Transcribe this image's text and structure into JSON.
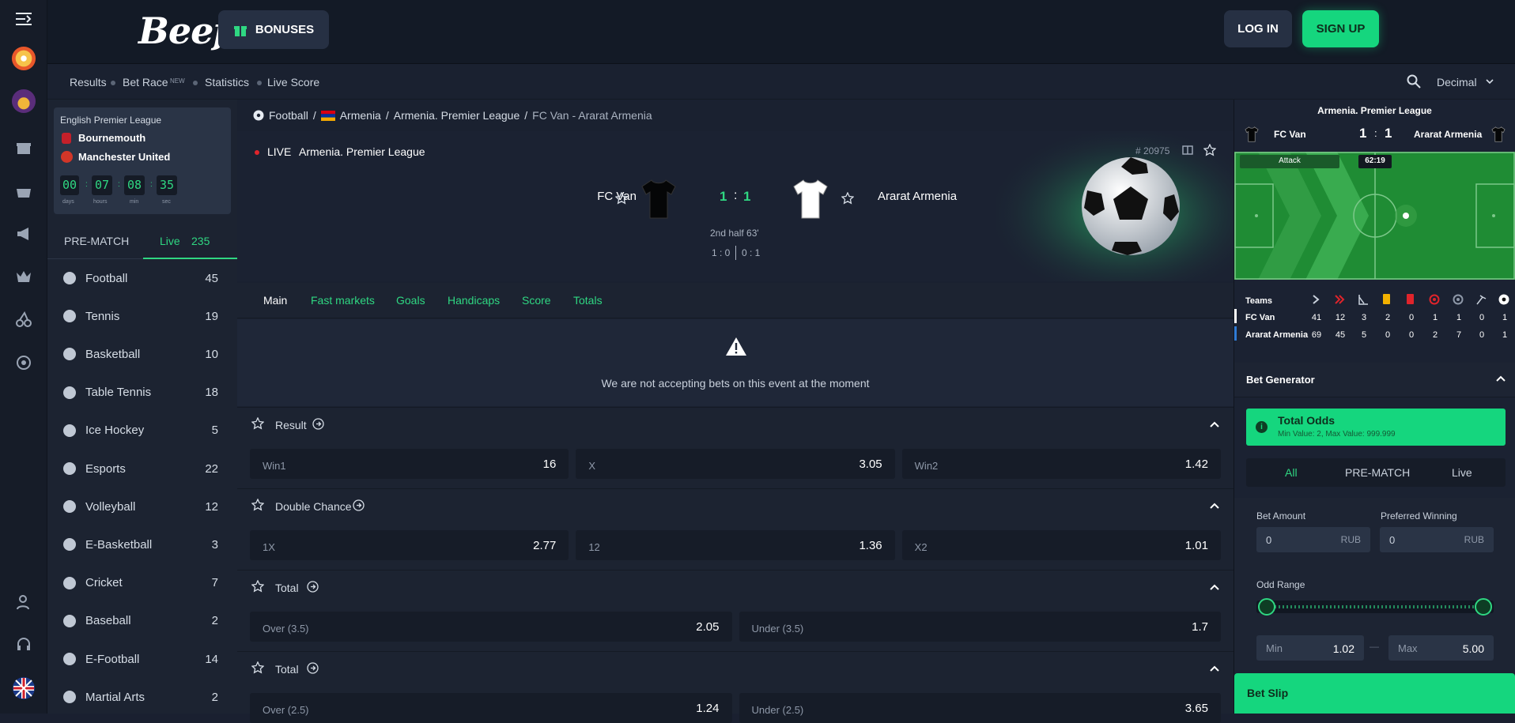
{
  "header": {
    "logo": "Beef",
    "bonuses_label": "BONUSES",
    "login_label": "LOG IN",
    "signup_label": "SIGN UP"
  },
  "subnav": {
    "items": [
      "Results",
      "Bet Race",
      "Statistics",
      "Live Score"
    ],
    "new_badge": "NEW",
    "odds_format": "Decimal"
  },
  "promo": {
    "league": "English Premier League",
    "team1": "Bournemouth",
    "team2": "Manchester United",
    "countdown": [
      {
        "value": "00",
        "unit": "days"
      },
      {
        "value": "07",
        "unit": "hours"
      },
      {
        "value": "08",
        "unit": "min"
      },
      {
        "value": "35",
        "unit": "sec"
      }
    ]
  },
  "sidebar": {
    "tab_prematch": "PRE-MATCH",
    "tab_live": "Live",
    "live_count": "235",
    "sports": [
      {
        "name": "Football",
        "count": "45"
      },
      {
        "name": "Tennis",
        "count": "19"
      },
      {
        "name": "Basketball",
        "count": "10"
      },
      {
        "name": "Table Tennis",
        "count": "18"
      },
      {
        "name": "Ice Hockey",
        "count": "5"
      },
      {
        "name": "Esports",
        "count": "22"
      },
      {
        "name": "Volleyball",
        "count": "12"
      },
      {
        "name": "E-Basketball",
        "count": "3"
      },
      {
        "name": "Cricket",
        "count": "7"
      },
      {
        "name": "Baseball",
        "count": "2"
      },
      {
        "name": "E-Football",
        "count": "14"
      },
      {
        "name": "Martial Arts",
        "count": "2"
      }
    ]
  },
  "breadcrumb": {
    "sport": "Football",
    "country": "Armenia",
    "league": "Armenia. Premier League",
    "event": "FC Van - Ararat Armenia"
  },
  "event": {
    "live_label": "LIVE",
    "league": "Armenia. Premier League",
    "event_id": "# 20975",
    "home": "FC Van",
    "away": "Ararat Armenia",
    "score_home": "1",
    "score_away": "1",
    "period": "2nd half 63'",
    "half1": "1 : 0",
    "half2": "0 : 1"
  },
  "market_tabs": [
    "Main",
    "Fast markets",
    "Goals",
    "Handicaps",
    "Score",
    "Totals"
  ],
  "notice": "We are not accepting bets on this event at the moment",
  "markets": [
    {
      "title": "Result",
      "odds": [
        {
          "label": "Win1",
          "value": "16"
        },
        {
          "label": "X",
          "value": "3.05"
        },
        {
          "label": "Win2",
          "value": "1.42"
        }
      ]
    },
    {
      "title": "Double Chance",
      "odds": [
        {
          "label": "1X",
          "value": "2.77"
        },
        {
          "label": "12",
          "value": "1.36"
        },
        {
          "label": "X2",
          "value": "1.01"
        }
      ]
    },
    {
      "title": "Total",
      "odds": [
        {
          "label": "Over (3.5)",
          "value": "2.05"
        },
        {
          "label": "Under (3.5)",
          "value": "1.7"
        }
      ]
    },
    {
      "title": "Total",
      "odds": [
        {
          "label": "Over (2.5)",
          "value": "1.24"
        },
        {
          "label": "Under (2.5)",
          "value": "3.65"
        }
      ]
    }
  ],
  "tracker": {
    "league": "Armenia. Premier League",
    "home": "FC Van",
    "away": "Ararat Armenia",
    "score_home": "1",
    "score_away": "1",
    "attack_label": "Attack",
    "clock": "62:19"
  },
  "stats": {
    "teams_label": "Teams",
    "rows": [
      {
        "team": "FC Van",
        "values": [
          "41",
          "12",
          "3",
          "2",
          "0",
          "1",
          "1",
          "0",
          "1"
        ]
      },
      {
        "team": "Ararat Armenia",
        "values": [
          "69",
          "45",
          "5",
          "0",
          "0",
          "2",
          "7",
          "0",
          "1"
        ]
      }
    ]
  },
  "bet_generator": {
    "title": "Bet Generator",
    "total_odds_title": "Total Odds",
    "total_odds_hint": "Min Value: 2, Max Value: 999.999",
    "tabs": [
      "All",
      "PRE-MATCH",
      "Live"
    ],
    "bet_amount_label": "Bet Amount",
    "preferred_winning_label": "Preferred Winning",
    "bet_amount": "0",
    "preferred_winning": "0",
    "currency": "RUB",
    "odd_range_label": "Odd Range",
    "min_label": "Min",
    "min_value": "1.02",
    "max_label": "Max",
    "max_value": "5.00",
    "dash": "—"
  },
  "bet_slip_label": "Bet Slip",
  "colors": {
    "accent": "#15d67e",
    "bg": "#1a2130",
    "live": "#e0242b"
  }
}
